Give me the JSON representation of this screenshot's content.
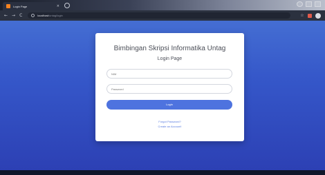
{
  "browser": {
    "tab_title": "Login Page",
    "tab_close": "×",
    "url_host": "localhost",
    "url_path": "/untag/login",
    "back_glyph": "←",
    "forward_glyph": "→",
    "reload_glyph": "C",
    "star_glyph": "☆"
  },
  "login": {
    "title": "Bimbingan Skripsi Informatika Untag",
    "subtitle": "Login Page",
    "nim_placeholder": "NIM",
    "password_placeholder": "Password",
    "login_label": "Login",
    "forgot_label": "Forgot Password?",
    "create_label": "Create an Account!"
  },
  "colors": {
    "background_top": "#4a76d6",
    "background_bottom": "#2c3fb3",
    "button": "#4e73df",
    "link": "#5b7ee0"
  },
  "icons": [
    "favicon",
    "new-tab-icon",
    "info-icon",
    "star-icon",
    "extension-icon",
    "profile-icon"
  ]
}
